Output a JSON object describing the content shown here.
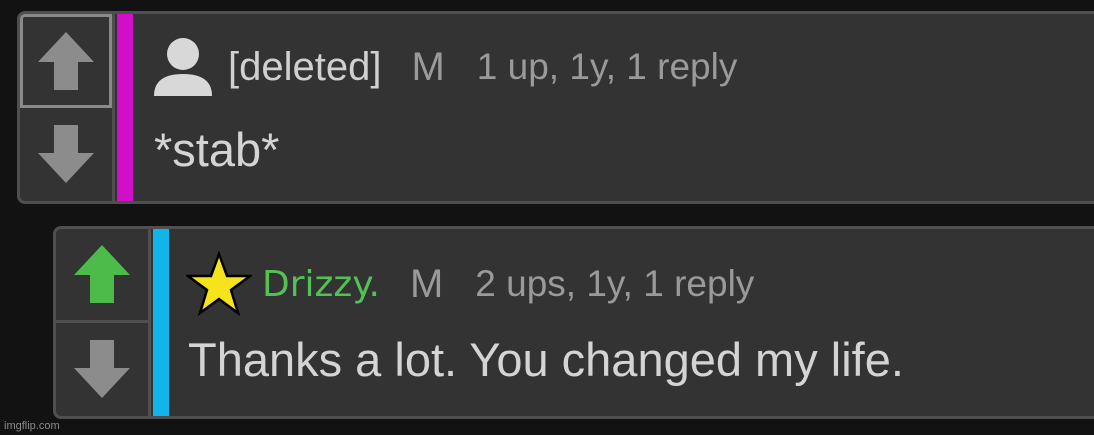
{
  "comments": [
    {
      "username": "[deleted]",
      "mod_flag": "M",
      "meta": "1 up, 1y, 1 reply",
      "body": "*stab*",
      "depth_color": "#d00fc9",
      "upvoted": false,
      "avatar": "user-silhouette-icon"
    },
    {
      "username": "Drizzy.",
      "mod_flag": "M",
      "meta": "2 ups, 1y, 1 reply",
      "body": "Thanks a lot. You changed my life.",
      "depth_color": "#12b4ec",
      "upvoted": true,
      "avatar": "star-icon",
      "username_color": "#52c255"
    }
  ],
  "colors": {
    "background": "#121212",
    "card": "#333333",
    "arrow_default": "#8c8c8c",
    "arrow_active": "#4cbb4a",
    "star_fill": "#f5e31c"
  },
  "watermark": "imgflip.com"
}
